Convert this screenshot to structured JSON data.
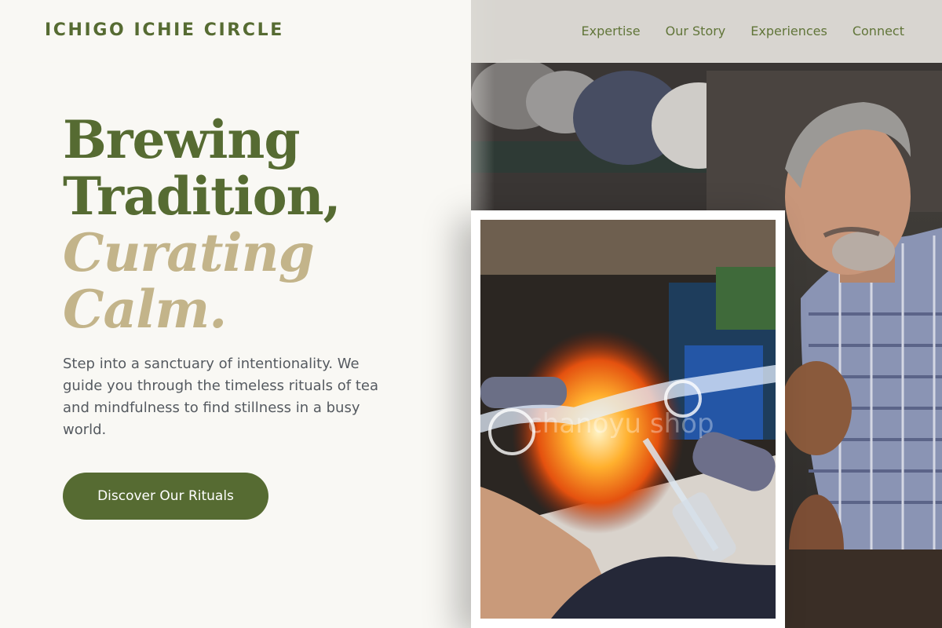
{
  "header": {
    "logo": "ICHIGO ICHIE CIRCLE",
    "nav": [
      "Expertise",
      "Our Story",
      "Experiences",
      "Connect"
    ]
  },
  "hero": {
    "headline_line1": "Brewing",
    "headline_line2": "Tradition,",
    "headline_line3": "Curating",
    "headline_line4": "Calm.",
    "lede": "Step into a sanctuary of intentionality. We guide you through the timeless rituals of tea and mindfulness to find stillness in a busy world.",
    "cta_label": "Discover Our Rituals"
  },
  "inset_image": {
    "watermark": "chanoyu shop"
  },
  "colors": {
    "brand_green": "#566b32",
    "accent_gold": "#c3b48a",
    "background": "#f9f8f4",
    "body_text": "#555a60"
  }
}
